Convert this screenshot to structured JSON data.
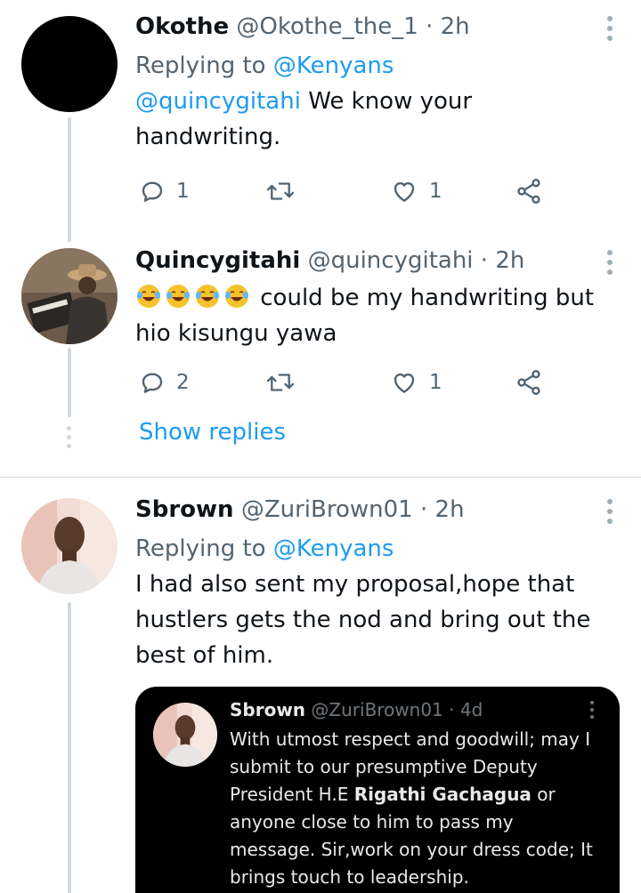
{
  "tweets": [
    {
      "name": "Okothe",
      "handle": "@Okothe_the_1",
      "time": "· 2h",
      "replying_prefix": "Replying to ",
      "replying_handle": "@Kenyans",
      "mention": "@quincygitahi",
      "text": " We know your handwriting.",
      "reply_count": "1",
      "retweet_count": "",
      "like_count": "1"
    },
    {
      "name": "Quincygitahi",
      "handle": "@quincygitahi",
      "time": "· 2h",
      "emoji": "😂😂😂😂",
      "text": "could be my handwriting but hio kisungu yawa",
      "reply_count": "2",
      "retweet_count": "",
      "like_count": "1"
    },
    {
      "name": "Sbrown",
      "handle": "@ZuriBrown01",
      "time": "· 2h",
      "replying_prefix": "Replying to ",
      "replying_handle": "@Kenyans",
      "text": "I had also sent my proposal,hope that hustlers gets the nod and bring out the best of him."
    }
  ],
  "show_replies": "Show replies",
  "quote": {
    "name": "Sbrown",
    "handle": "@ZuriBrown01",
    "time": "· 4d",
    "text_before": "With utmost respect and goodwill; may I submit to our presumptive Deputy President H.E ",
    "text_bold": "Rigathi Gachagua",
    "text_after": " or anyone close to him to pass my message. Sir,work on your dress code; It brings touch to leadership."
  },
  "icons": {
    "reply": "reply-icon",
    "retweet": "retweet-icon",
    "like": "heart-icon",
    "share": "share-icon",
    "more": "more-vertical-icon"
  },
  "colors": {
    "link": "#1d9bf0",
    "secondary_text": "#536471",
    "thread_line": "#cfd9de",
    "quote_bg": "#000000"
  }
}
